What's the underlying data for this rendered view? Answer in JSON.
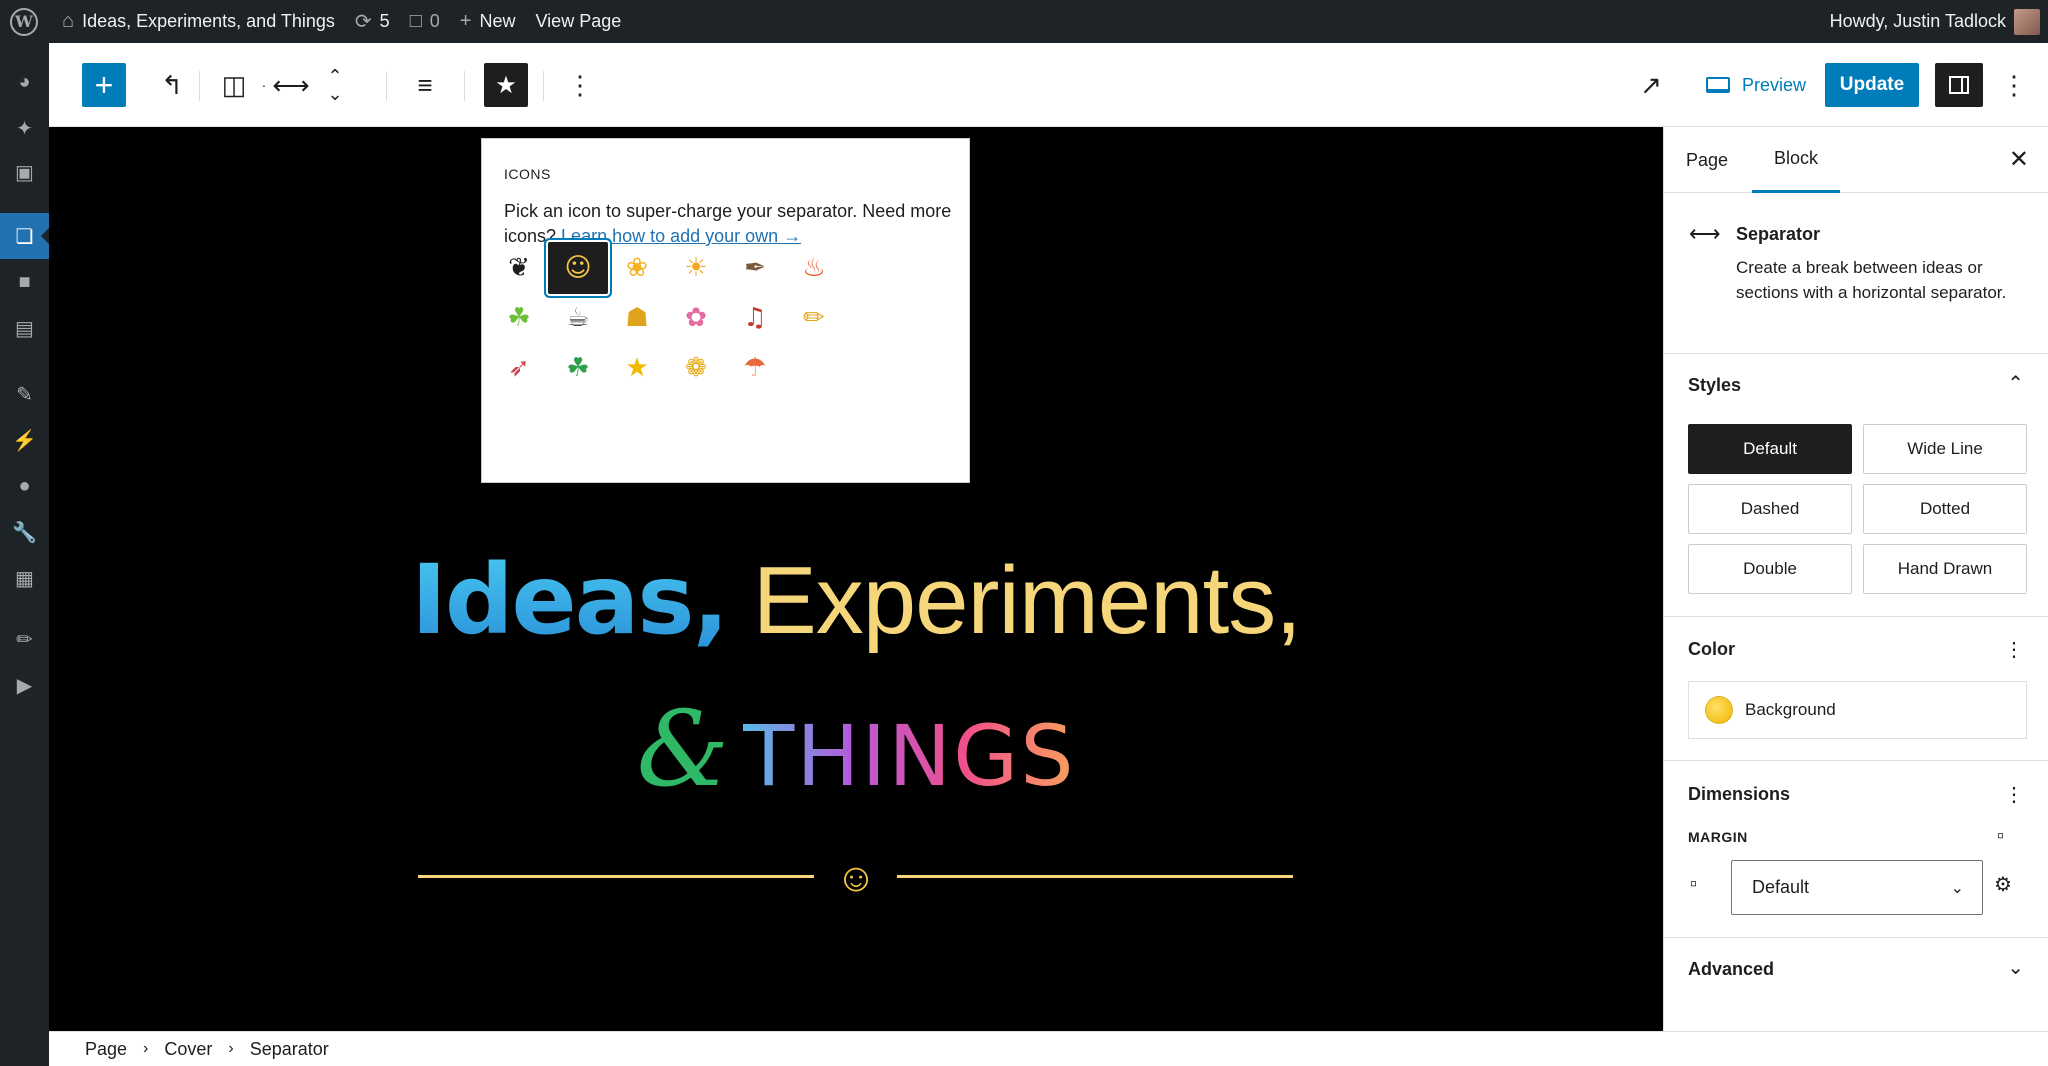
{
  "adminbar": {
    "site_name": "Ideas, Experiments, and Things",
    "updates_count": "5",
    "comments_count": "0",
    "new_label": "New",
    "view_page_label": "View Page",
    "howdy": "Howdy, Justin Tadlock"
  },
  "toolbar": {
    "preview_label": "Preview",
    "update_label": "Update"
  },
  "popover": {
    "title": "ICONS",
    "description": "Pick an icon to super-charge your separator. Need more icons?",
    "link_text": "Learn how to add your own →",
    "icons": [
      {
        "name": "bee-icon",
        "glyph": "❦",
        "color": "#1e1e1e"
      },
      {
        "name": "melting-face-icon",
        "glyph": "☺",
        "color": "#f7c844"
      },
      {
        "name": "flower-icon",
        "glyph": "❀",
        "color": "#f5b120"
      },
      {
        "name": "sun-icon",
        "glyph": "☀",
        "color": "#f5a623"
      },
      {
        "name": "feather-icon",
        "glyph": "✒",
        "color": "#7a5a3a"
      },
      {
        "name": "fire-icon",
        "glyph": "♨",
        "color": "#e8501c"
      },
      {
        "name": "leaf-icon",
        "glyph": "☘",
        "color": "#6bbf3b"
      },
      {
        "name": "coffee-icon",
        "glyph": "☕",
        "color": "#444444"
      },
      {
        "name": "beer-icon",
        "glyph": "☗",
        "color": "#e0a31c"
      },
      {
        "name": "lotus-icon",
        "glyph": "✿",
        "color": "#e36b9f"
      },
      {
        "name": "guitar-icon",
        "glyph": "♫",
        "color": "#c63a2c"
      },
      {
        "name": "pencil-icon",
        "glyph": "✏",
        "color": "#e8a21c"
      },
      {
        "name": "rocket-icon",
        "glyph": "➶",
        "color": "#c9414a"
      },
      {
        "name": "shamrock-icon",
        "glyph": "☘",
        "color": "#2ea04a"
      },
      {
        "name": "star-icon",
        "glyph": "★",
        "color": "#f5b800"
      },
      {
        "name": "sunflower-icon",
        "glyph": "❁",
        "color": "#e5a90f"
      },
      {
        "name": "umbrella-icon",
        "glyph": "☂",
        "color": "#e86a3a"
      }
    ]
  },
  "canvas": {
    "line1_bold": "Ideas,",
    "line1_light": " Experiments,",
    "line2_amp": "&",
    "line2_things": "THINGS"
  },
  "sidebar": {
    "tab_page": "Page",
    "tab_block": "Block",
    "block_title": "Separator",
    "block_desc": "Create a break between ideas or sections with a horizontal separator.",
    "styles_title": "Styles",
    "styles": [
      "Default",
      "Wide Line",
      "Dashed",
      "Dotted",
      "Double",
      "Hand Drawn"
    ],
    "color_title": "Color",
    "background_label": "Background",
    "dimensions_title": "Dimensions",
    "margin_label": "MARGIN",
    "margin_value": "Default",
    "advanced_title": "Advanced"
  },
  "breadcrumb": [
    "Page",
    "Cover",
    "Separator"
  ]
}
